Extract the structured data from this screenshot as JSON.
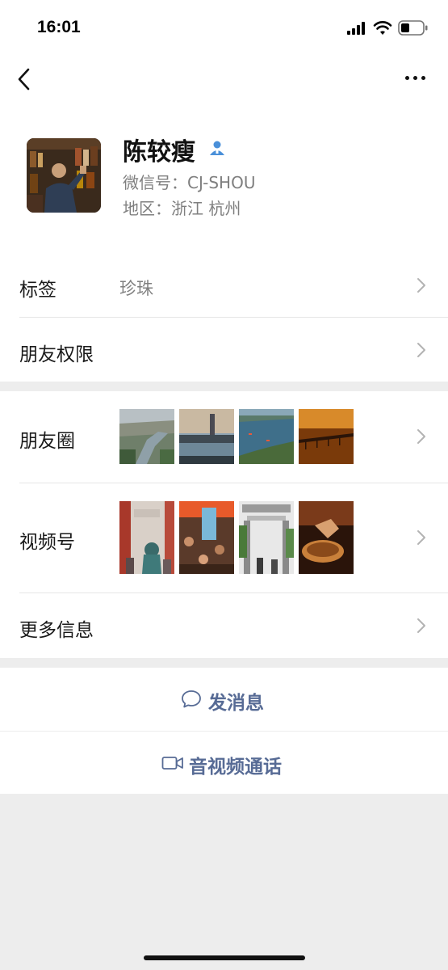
{
  "status_bar": {
    "time": "16:01"
  },
  "profile": {
    "name": "陈较瘦",
    "wechat_id": "微信号：CJ-SHOU",
    "region": "地区：浙江 杭州"
  },
  "rows": {
    "tags_label": "标签",
    "tags_value": "珍珠",
    "permissions_label": "朋友权限",
    "moments_label": "朋友圈",
    "channels_label": "视频号",
    "more_info_label": "更多信息"
  },
  "actions": {
    "message_label": "发消息",
    "call_label": "音视频通话"
  },
  "colors": {
    "link_blue": "#576b95",
    "contact_icon": "#4a90d9",
    "background": "#ededed"
  },
  "icons": {
    "back": "chevron-left-icon",
    "more": "ellipsis-icon",
    "contact_badge": "person-icon",
    "row_arrow": "chevron-right-icon",
    "message": "chat-bubble-icon",
    "call": "video-camera-icon"
  }
}
